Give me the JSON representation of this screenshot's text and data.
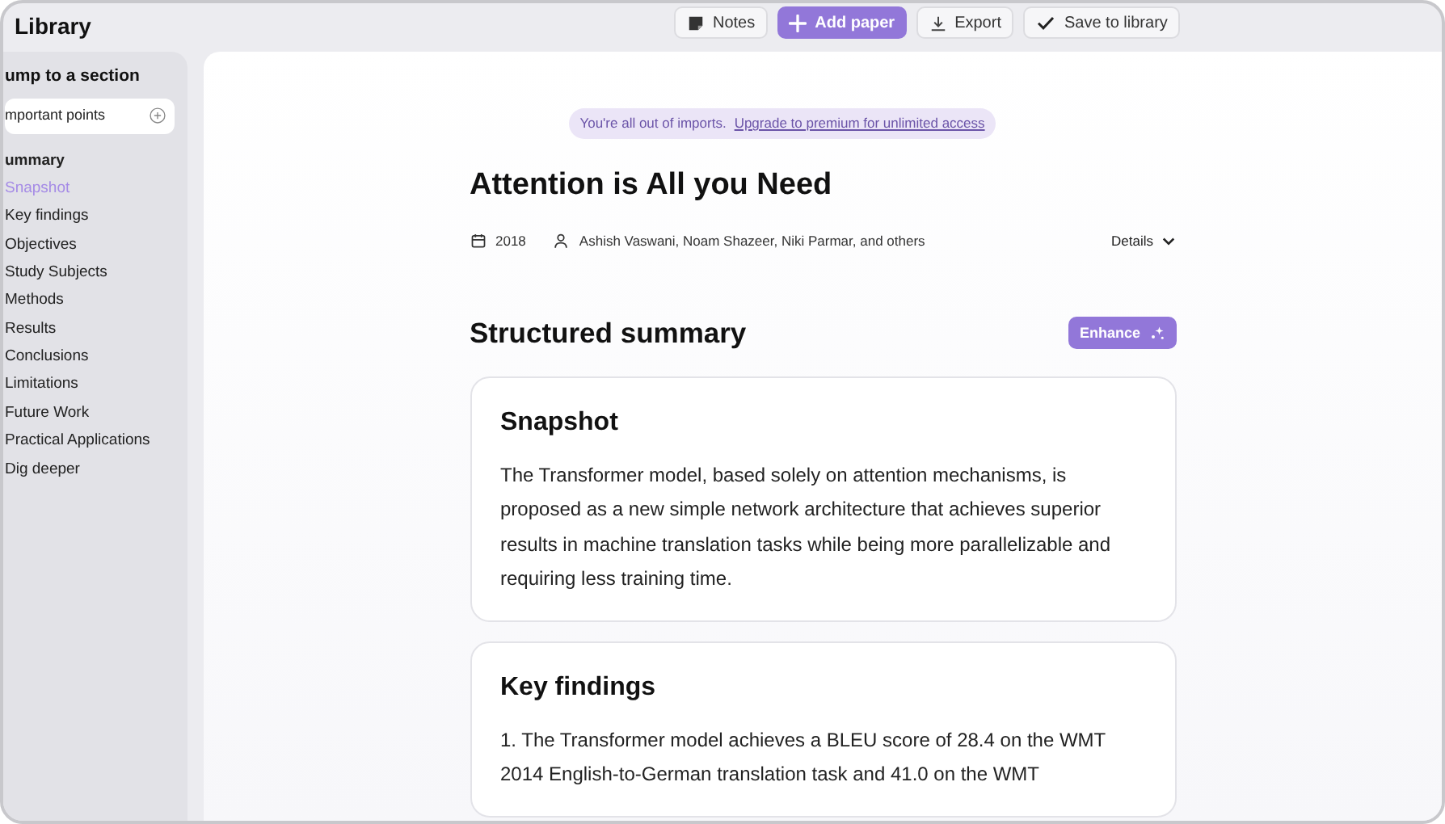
{
  "window": {
    "title": "Library"
  },
  "toolbar": [
    {
      "kind": "notes",
      "label": "Notes",
      "primary": false
    },
    {
      "kind": "add",
      "label": "Add paper",
      "primary": true
    },
    {
      "kind": "export",
      "label": "Export",
      "primary": false
    },
    {
      "kind": "save",
      "label": "Save to library",
      "primary": false
    }
  ],
  "sidebar": {
    "heading": "ump to a section",
    "search": {
      "value": "mportant points"
    },
    "group": "ummary",
    "items": [
      {
        "label": "Snapshot",
        "selected": true
      },
      {
        "label": "Key findings",
        "selected": false
      },
      {
        "label": "Objectives",
        "selected": false
      },
      {
        "label": "Study Subjects",
        "selected": false
      },
      {
        "label": "Methods",
        "selected": false
      },
      {
        "label": "Results",
        "selected": false
      },
      {
        "label": "Conclusions",
        "selected": false
      },
      {
        "label": "Limitations",
        "selected": false
      },
      {
        "label": "Future Work",
        "selected": false
      },
      {
        "label": "Practical Applications",
        "selected": false
      },
      {
        "label": "Dig deeper",
        "selected": false
      }
    ]
  },
  "banner": {
    "text": "You're all out of imports.",
    "link": "Upgrade to premium for unlimited access"
  },
  "paper": {
    "title": "Attention is All you Need",
    "year": "2018",
    "authors": "Ashish Vaswani, Noam Shazeer, Niki Parmar, and others",
    "details": "Details"
  },
  "summary": {
    "heading": "Structured summary",
    "enhance": "Enhance",
    "cards": [
      {
        "title": "Snapshot",
        "body": "The Transformer model, based solely on attention mechanisms, is proposed as a new simple network architecture that achieves superior results in machine translation tasks while being more parallelizable and requiring less training time."
      },
      {
        "title": "Key findings",
        "body": "1. The Transformer model achieves a BLEU score of 28.4 on the WMT 2014 English-to-German translation task and 41.0 on the WMT"
      }
    ]
  }
}
